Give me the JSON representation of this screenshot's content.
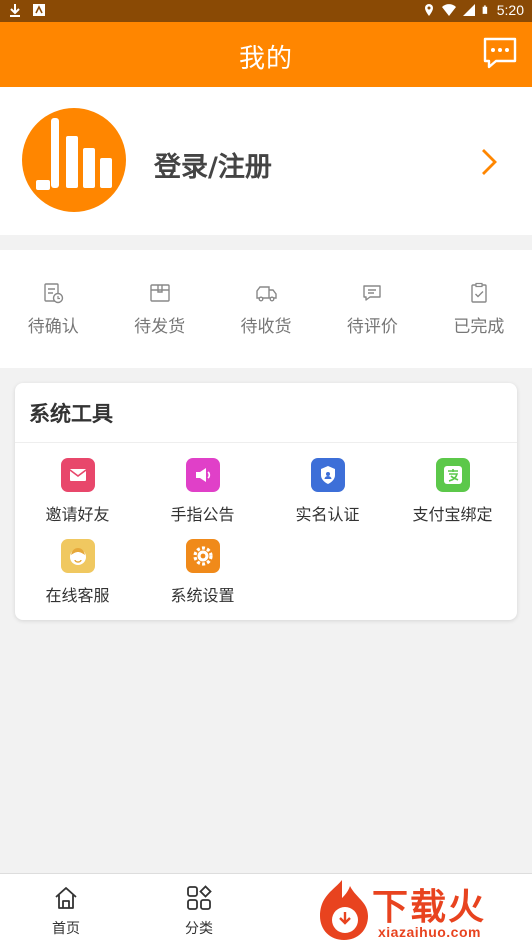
{
  "status_bar": {
    "time": "5:20"
  },
  "header": {
    "title": "我的"
  },
  "profile": {
    "login_label": "登录/注册"
  },
  "orders": [
    {
      "label": "待确认",
      "icon": "pending-confirm-icon"
    },
    {
      "label": "待发货",
      "icon": "pending-ship-icon"
    },
    {
      "label": "待收货",
      "icon": "pending-receive-icon"
    },
    {
      "label": "待评价",
      "icon": "pending-review-icon"
    },
    {
      "label": "已完成",
      "icon": "completed-icon"
    }
  ],
  "tools": {
    "title": "系统工具",
    "items": [
      {
        "label": "邀请好友",
        "icon": "invite-friend-icon",
        "color": "#e8476b"
      },
      {
        "label": "手指公告",
        "icon": "announcement-icon",
        "color": "#e040c8"
      },
      {
        "label": "实名认证",
        "icon": "id-verify-icon",
        "color": "#3d6fd8"
      },
      {
        "label": "支付宝绑定",
        "icon": "alipay-bind-icon",
        "color": "#5cc84a"
      },
      {
        "label": "在线客服",
        "icon": "customer-service-icon",
        "color": "#f0c860"
      },
      {
        "label": "系统设置",
        "icon": "settings-icon",
        "color": "#f08a1a"
      }
    ]
  },
  "tabbar": [
    {
      "label": "首页",
      "icon": "home-icon"
    },
    {
      "label": "分类",
      "icon": "category-icon"
    }
  ],
  "watermark": {
    "brand": "下载火",
    "domain": "xiazaihuo.com"
  },
  "colors": {
    "accent": "#ff8600",
    "status_bar": "#8a4a05"
  }
}
